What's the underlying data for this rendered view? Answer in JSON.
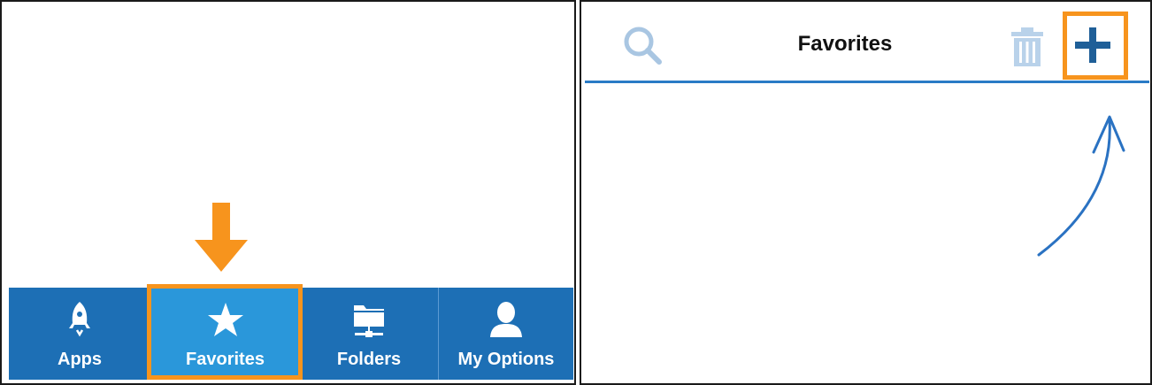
{
  "left_panel": {
    "tabbar": {
      "tabs": [
        {
          "id": "apps",
          "label": "Apps",
          "icon": "rocket-icon"
        },
        {
          "id": "favorites",
          "label": "Favorites",
          "icon": "star-icon",
          "selected": true
        },
        {
          "id": "folders",
          "label": "Folders",
          "icon": "folder-network-icon"
        },
        {
          "id": "myoptions",
          "label": "My Options",
          "icon": "person-icon"
        }
      ],
      "bar_color": "#1d6fb5",
      "selected_color": "#2a97da"
    },
    "annotation": {
      "highlight_color": "#f7941d",
      "arrow_icon": "down-arrow-icon"
    }
  },
  "right_panel": {
    "header": {
      "title": "Favorites",
      "search_icon": "search-icon",
      "trash_icon": "trash-icon",
      "add_icon": "plus-icon",
      "accent_color": "#2a7bc6"
    },
    "annotation": {
      "highlight_color": "#f7941d",
      "arrow_icon": "curved-arrow-icon"
    }
  }
}
